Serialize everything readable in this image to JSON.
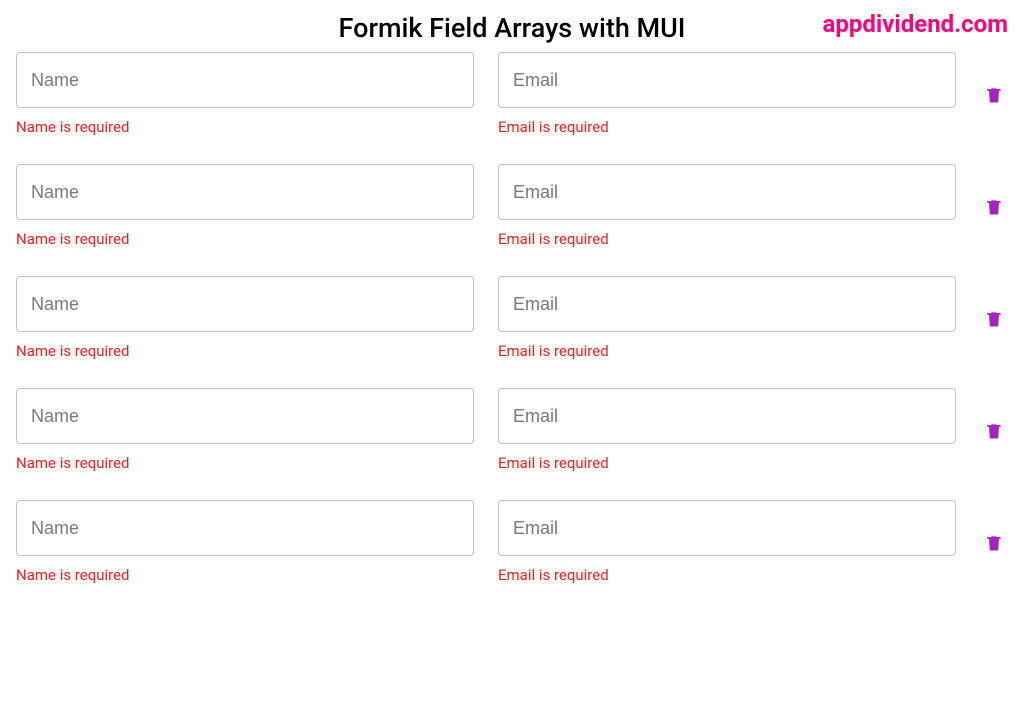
{
  "header": {
    "title": "Formik Field Arrays with MUI",
    "brand": "appdividend.com"
  },
  "fields": {
    "name": {
      "placeholder": "Name",
      "error": "Name is required"
    },
    "email": {
      "placeholder": "Email",
      "error": "Email is required"
    }
  },
  "rows": [
    {
      "name": "",
      "email": ""
    },
    {
      "name": "",
      "email": ""
    },
    {
      "name": "",
      "email": ""
    },
    {
      "name": "",
      "email": ""
    },
    {
      "name": "",
      "email": ""
    }
  ],
  "icons": {
    "trash": "trash-icon"
  },
  "colors": {
    "brand": "#ff007f",
    "error": "#ff1c1c",
    "trash": "#a921c2"
  }
}
